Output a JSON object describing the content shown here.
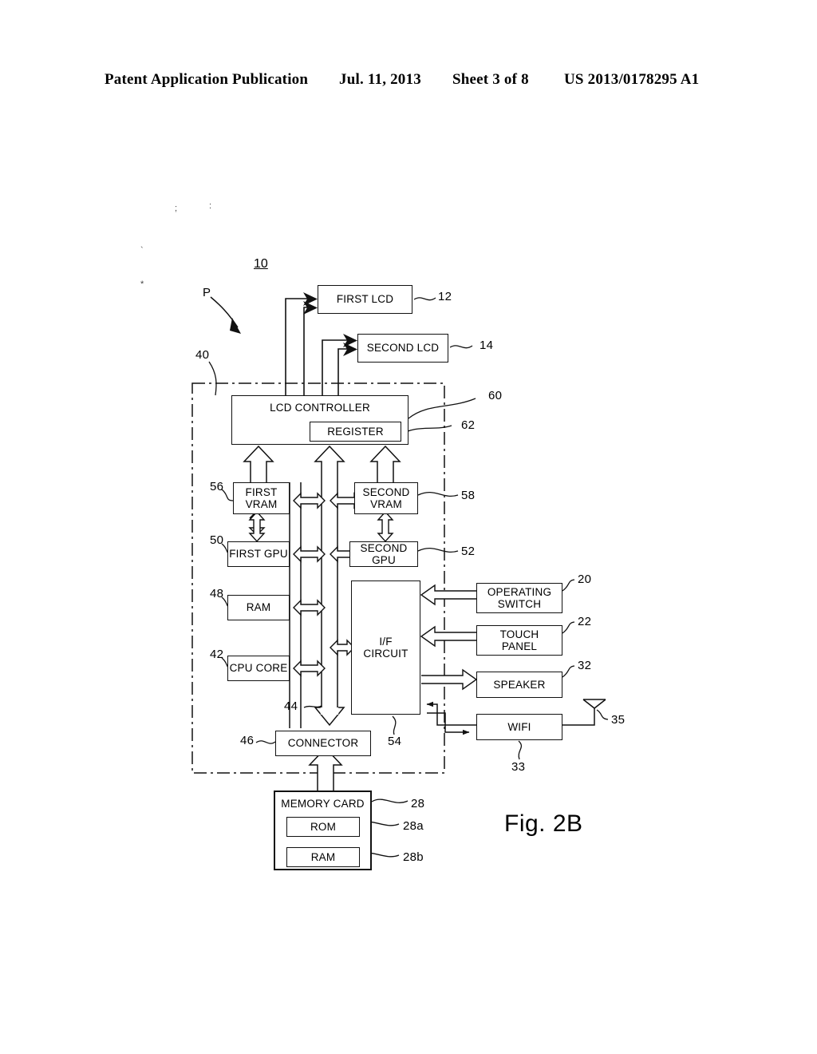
{
  "header": {
    "title": "Patent Application Publication",
    "date": "Jul. 11, 2013",
    "sheet": "Sheet 3 of 8",
    "publication_number": "US 2013/0178295 A1"
  },
  "figure": {
    "caption": "Fig. 2B",
    "system_number": "10",
    "device_pointer_label": "P",
    "housing_ref": "40",
    "speck_marks": [
      ";",
      ":",
      "`",
      "*"
    ]
  },
  "blocks": [
    {
      "id": "first-lcd",
      "label": "FIRST LCD",
      "ref": "12"
    },
    {
      "id": "second-lcd",
      "label": "SECOND LCD",
      "ref": "14"
    },
    {
      "id": "lcd-controller",
      "label": "LCD CONTROLLER",
      "ref": "60"
    },
    {
      "id": "register",
      "label": "REGISTER",
      "ref": "62"
    },
    {
      "id": "first-vram",
      "label": "FIRST\nVRAM",
      "ref": "56"
    },
    {
      "id": "second-vram",
      "label": "SECOND\nVRAM",
      "ref": "58"
    },
    {
      "id": "first-gpu",
      "label": "FIRST GPU",
      "ref": "50"
    },
    {
      "id": "second-gpu",
      "label": "SECOND GPU",
      "ref": "52"
    },
    {
      "id": "ram",
      "label": "RAM",
      "ref": "48"
    },
    {
      "id": "cpu-core",
      "label": "CPU CORE",
      "ref": "42"
    },
    {
      "id": "if-circuit",
      "label": "I/F\nCIRCUIT",
      "ref": "54"
    },
    {
      "id": "operating-switch",
      "label": "OPERATING\nSWITCH",
      "ref": "20"
    },
    {
      "id": "touch-panel",
      "label": "TOUCH\nPANEL",
      "ref": "22"
    },
    {
      "id": "speaker",
      "label": "SPEAKER",
      "ref": "32"
    },
    {
      "id": "wifi",
      "label": "WIFI",
      "ref": "33"
    },
    {
      "id": "antenna",
      "label": "",
      "ref": "35"
    },
    {
      "id": "connector",
      "label": "CONNECTOR",
      "ref": "46"
    },
    {
      "id": "bus",
      "label": "",
      "ref": "44"
    },
    {
      "id": "memory-card",
      "label": "MEMORY CARD",
      "ref": "28"
    },
    {
      "id": "memory-card-rom",
      "label": "ROM",
      "ref": "28a"
    },
    {
      "id": "memory-card-ram",
      "label": "RAM",
      "ref": "28b"
    }
  ],
  "labels": {
    "first_lcd": "FIRST LCD",
    "second_lcd": "SECOND LCD",
    "lcd_controller": "LCD CONTROLLER",
    "register": "REGISTER",
    "first_vram_l1": "FIRST",
    "first_vram_l2": "VRAM",
    "second_vram_l1": "SECOND",
    "second_vram_l2": "VRAM",
    "first_gpu": "FIRST GPU",
    "second_gpu": "SECOND GPU",
    "ram": "RAM",
    "cpu_core": "CPU CORE",
    "if_circuit_l1": "I/F",
    "if_circuit_l2": "CIRCUIT",
    "operating_switch_l1": "OPERATING",
    "operating_switch_l2": "SWITCH",
    "touch_panel_l1": "TOUCH",
    "touch_panel_l2": "PANEL",
    "speaker": "SPEAKER",
    "wifi": "WIFI",
    "connector": "CONNECTOR",
    "memory_card": "MEMORY CARD",
    "memory_card_rom": "ROM",
    "memory_card_ram": "RAM"
  },
  "refs": {
    "r10": "10",
    "r12": "12",
    "r14": "14",
    "r20": "20",
    "r22": "22",
    "r28": "28",
    "r28a": "28a",
    "r28b": "28b",
    "r32": "32",
    "r33": "33",
    "r35": "35",
    "r40": "40",
    "r42": "42",
    "r44": "44",
    "r46": "46",
    "r48": "48",
    "r50": "50",
    "r52": "52",
    "r54": "54",
    "r56": "56",
    "r58": "58",
    "r60": "60",
    "r62": "62",
    "rP": "P"
  },
  "colors": {
    "ink": "#111111",
    "paper": "#ffffff"
  }
}
